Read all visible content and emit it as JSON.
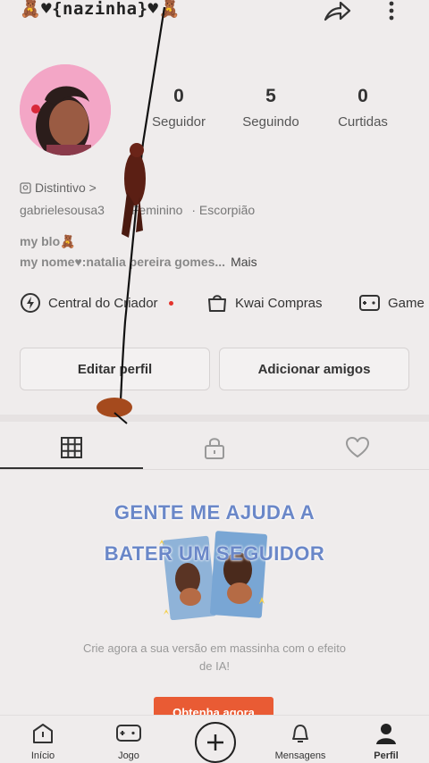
{
  "header": {
    "username": "🧸♥{nazinha}♥🧸",
    "share_icon": "share-icon",
    "more_icon": "more-vertical-icon"
  },
  "stats": [
    {
      "value": "0",
      "label": "Seguidor"
    },
    {
      "value": "5",
      "label": "Seguindo"
    },
    {
      "value": "0",
      "label": "Curtidas"
    }
  ],
  "profile": {
    "badge_label": "Distintivo >",
    "user_id": "gabrielesousa3",
    "gender": "Feminino",
    "sign": "· Escorpião",
    "bio_line1": "my blo🧸",
    "bio_line2": "my nome♥:natalia pereira gomes...",
    "bio_more": "Mais"
  },
  "quick_links": [
    {
      "label": "Central do Criador",
      "icon": "lightning-icon"
    },
    {
      "label": "Kwai Compras",
      "icon": "shopping-bag-icon"
    },
    {
      "label": "Game",
      "icon": "gamepad-icon"
    }
  ],
  "buttons": {
    "edit_profile": "Editar perfil",
    "add_friends": "Adicionar amigos"
  },
  "tabs": [
    {
      "icon": "grid-icon",
      "active": true
    },
    {
      "icon": "lock-icon",
      "active": false
    },
    {
      "icon": "heart-icon",
      "active": false
    }
  ],
  "promo": {
    "title_line1": "GENTE ME AJUDA A",
    "title_line2": "BATER UM SEGUIDOR",
    "description": "Crie agora a sua versão em massinha com o efeito de IA!",
    "cta": "Obtenha agora"
  },
  "bottom_nav": [
    {
      "label": "Início",
      "icon": "home-icon"
    },
    {
      "label": "Jogo",
      "icon": "gamepad-icon"
    },
    {
      "label": "",
      "icon": "plus-circle-icon"
    },
    {
      "label": "Mensagens",
      "icon": "bell-icon"
    },
    {
      "label": "Perfil",
      "icon": "person-icon",
      "active": true
    }
  ],
  "colors": {
    "accent": "#e95b34",
    "promo_title": "#6a87c8",
    "notification_dot": "#e4322b"
  }
}
